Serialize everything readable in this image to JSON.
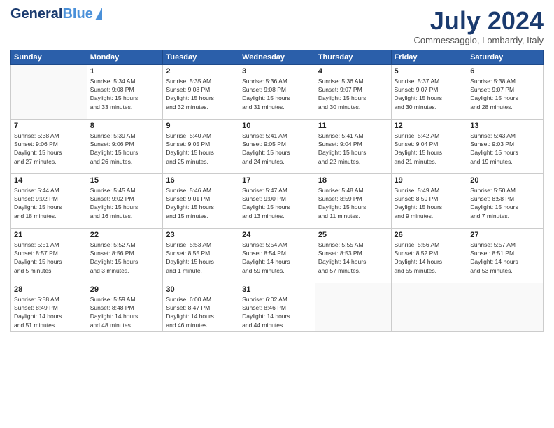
{
  "header": {
    "logo_general": "General",
    "logo_blue": "Blue",
    "month_title": "July 2024",
    "location": "Commessaggio, Lombardy, Italy"
  },
  "weekdays": [
    "Sunday",
    "Monday",
    "Tuesday",
    "Wednesday",
    "Thursday",
    "Friday",
    "Saturday"
  ],
  "weeks": [
    [
      {
        "day": "",
        "info": ""
      },
      {
        "day": "1",
        "info": "Sunrise: 5:34 AM\nSunset: 9:08 PM\nDaylight: 15 hours\nand 33 minutes."
      },
      {
        "day": "2",
        "info": "Sunrise: 5:35 AM\nSunset: 9:08 PM\nDaylight: 15 hours\nand 32 minutes."
      },
      {
        "day": "3",
        "info": "Sunrise: 5:36 AM\nSunset: 9:08 PM\nDaylight: 15 hours\nand 31 minutes."
      },
      {
        "day": "4",
        "info": "Sunrise: 5:36 AM\nSunset: 9:07 PM\nDaylight: 15 hours\nand 30 minutes."
      },
      {
        "day": "5",
        "info": "Sunrise: 5:37 AM\nSunset: 9:07 PM\nDaylight: 15 hours\nand 30 minutes."
      },
      {
        "day": "6",
        "info": "Sunrise: 5:38 AM\nSunset: 9:07 PM\nDaylight: 15 hours\nand 28 minutes."
      }
    ],
    [
      {
        "day": "7",
        "info": "Sunrise: 5:38 AM\nSunset: 9:06 PM\nDaylight: 15 hours\nand 27 minutes."
      },
      {
        "day": "8",
        "info": "Sunrise: 5:39 AM\nSunset: 9:06 PM\nDaylight: 15 hours\nand 26 minutes."
      },
      {
        "day": "9",
        "info": "Sunrise: 5:40 AM\nSunset: 9:05 PM\nDaylight: 15 hours\nand 25 minutes."
      },
      {
        "day": "10",
        "info": "Sunrise: 5:41 AM\nSunset: 9:05 PM\nDaylight: 15 hours\nand 24 minutes."
      },
      {
        "day": "11",
        "info": "Sunrise: 5:41 AM\nSunset: 9:04 PM\nDaylight: 15 hours\nand 22 minutes."
      },
      {
        "day": "12",
        "info": "Sunrise: 5:42 AM\nSunset: 9:04 PM\nDaylight: 15 hours\nand 21 minutes."
      },
      {
        "day": "13",
        "info": "Sunrise: 5:43 AM\nSunset: 9:03 PM\nDaylight: 15 hours\nand 19 minutes."
      }
    ],
    [
      {
        "day": "14",
        "info": "Sunrise: 5:44 AM\nSunset: 9:02 PM\nDaylight: 15 hours\nand 18 minutes."
      },
      {
        "day": "15",
        "info": "Sunrise: 5:45 AM\nSunset: 9:02 PM\nDaylight: 15 hours\nand 16 minutes."
      },
      {
        "day": "16",
        "info": "Sunrise: 5:46 AM\nSunset: 9:01 PM\nDaylight: 15 hours\nand 15 minutes."
      },
      {
        "day": "17",
        "info": "Sunrise: 5:47 AM\nSunset: 9:00 PM\nDaylight: 15 hours\nand 13 minutes."
      },
      {
        "day": "18",
        "info": "Sunrise: 5:48 AM\nSunset: 8:59 PM\nDaylight: 15 hours\nand 11 minutes."
      },
      {
        "day": "19",
        "info": "Sunrise: 5:49 AM\nSunset: 8:59 PM\nDaylight: 15 hours\nand 9 minutes."
      },
      {
        "day": "20",
        "info": "Sunrise: 5:50 AM\nSunset: 8:58 PM\nDaylight: 15 hours\nand 7 minutes."
      }
    ],
    [
      {
        "day": "21",
        "info": "Sunrise: 5:51 AM\nSunset: 8:57 PM\nDaylight: 15 hours\nand 5 minutes."
      },
      {
        "day": "22",
        "info": "Sunrise: 5:52 AM\nSunset: 8:56 PM\nDaylight: 15 hours\nand 3 minutes."
      },
      {
        "day": "23",
        "info": "Sunrise: 5:53 AM\nSunset: 8:55 PM\nDaylight: 15 hours\nand 1 minute."
      },
      {
        "day": "24",
        "info": "Sunrise: 5:54 AM\nSunset: 8:54 PM\nDaylight: 14 hours\nand 59 minutes."
      },
      {
        "day": "25",
        "info": "Sunrise: 5:55 AM\nSunset: 8:53 PM\nDaylight: 14 hours\nand 57 minutes."
      },
      {
        "day": "26",
        "info": "Sunrise: 5:56 AM\nSunset: 8:52 PM\nDaylight: 14 hours\nand 55 minutes."
      },
      {
        "day": "27",
        "info": "Sunrise: 5:57 AM\nSunset: 8:51 PM\nDaylight: 14 hours\nand 53 minutes."
      }
    ],
    [
      {
        "day": "28",
        "info": "Sunrise: 5:58 AM\nSunset: 8:49 PM\nDaylight: 14 hours\nand 51 minutes."
      },
      {
        "day": "29",
        "info": "Sunrise: 5:59 AM\nSunset: 8:48 PM\nDaylight: 14 hours\nand 48 minutes."
      },
      {
        "day": "30",
        "info": "Sunrise: 6:00 AM\nSunset: 8:47 PM\nDaylight: 14 hours\nand 46 minutes."
      },
      {
        "day": "31",
        "info": "Sunrise: 6:02 AM\nSunset: 8:46 PM\nDaylight: 14 hours\nand 44 minutes."
      },
      {
        "day": "",
        "info": ""
      },
      {
        "day": "",
        "info": ""
      },
      {
        "day": "",
        "info": ""
      }
    ]
  ]
}
